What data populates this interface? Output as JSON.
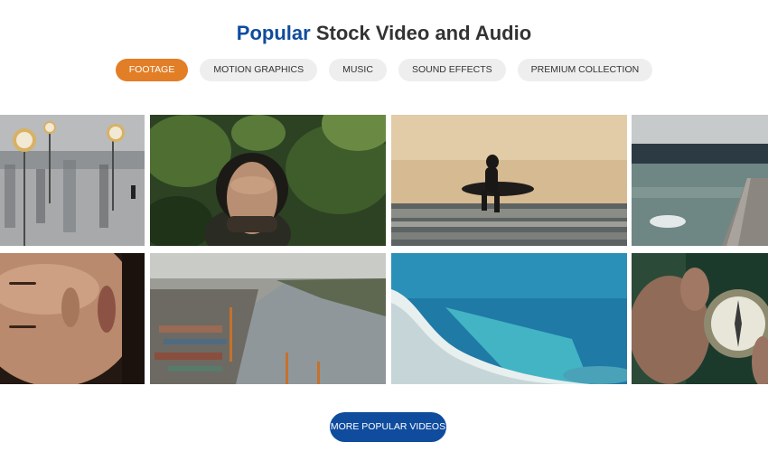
{
  "header": {
    "title_accent": "Popular",
    "title_rest": " Stock Video and Audio"
  },
  "tabs": [
    {
      "label": "FOOTAGE",
      "active": true
    },
    {
      "label": "MOTION GRAPHICS",
      "active": false
    },
    {
      "label": "MUSIC",
      "active": false
    },
    {
      "label": "SOUND EFFECTS",
      "active": false
    },
    {
      "label": "PREMIUM COLLECTION",
      "active": false
    }
  ],
  "colors": {
    "accent_orange": "#e27e26",
    "brand_blue": "#0f4c9e",
    "tab_bg": "#eeeeee"
  },
  "gallery": [
    {
      "subject": "commuters-with-clocks"
    },
    {
      "subject": "man-in-forest"
    },
    {
      "subject": "surfer-at-sunset"
    },
    {
      "subject": "lake-pier"
    },
    {
      "subject": "smiling-woman"
    },
    {
      "subject": "port-and-river-aerial"
    },
    {
      "subject": "ocean-wave"
    },
    {
      "subject": "hand-holding-compass"
    }
  ],
  "cta": {
    "more_label": "MORE POPULAR VIDEOS"
  }
}
